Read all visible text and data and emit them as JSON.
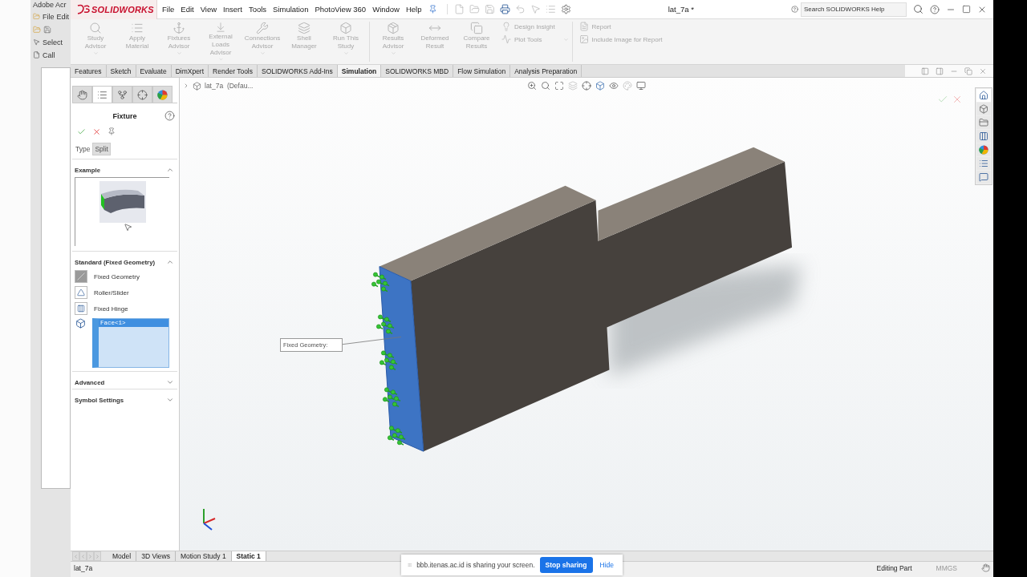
{
  "background_app": {
    "title": "Adobe Acr",
    "menu": [
      "File",
      "Edit"
    ],
    "tool": "Select",
    "tab": "Call"
  },
  "window": {
    "brand": "SOLIDWORKS",
    "menu": [
      "File",
      "Edit",
      "View",
      "Insert",
      "Tools",
      "Simulation",
      "PhotoView 360",
      "Window",
      "Help"
    ],
    "title": "lat_7a *",
    "search": {
      "placeholder": "Search SOLIDWORKS Help"
    }
  },
  "ribbon": {
    "groups": [
      {
        "large": [
          {
            "kind": "study",
            "label": "Study Advisor",
            "dropdown": true,
            "disabled": true
          },
          {
            "kind": "material",
            "label": "Apply Material",
            "dropdown": false,
            "disabled": true
          },
          {
            "kind": "fixtures",
            "label": "Fixtures Advisor",
            "dropdown": true,
            "disabled": true
          },
          {
            "kind": "loads",
            "label": "External Loads Advisor",
            "dropdown": true,
            "disabled": true
          },
          {
            "kind": "connections",
            "label": "Connections Advisor",
            "dropdown": true,
            "disabled": true
          },
          {
            "kind": "shell",
            "label": "Shell Manager",
            "dropdown": false,
            "disabled": true
          },
          {
            "kind": "run",
            "label": "Run This Study",
            "dropdown": true,
            "disabled": true
          }
        ]
      },
      {
        "large": [
          {
            "kind": "results",
            "label": "Results Advisor",
            "dropdown": true,
            "disabled": true
          },
          {
            "kind": "deformed",
            "label": "Deformed Result",
            "dropdown": false,
            "disabled": true
          },
          {
            "kind": "compare",
            "label": "Compare Results",
            "dropdown": false,
            "disabled": true
          }
        ],
        "small": [
          {
            "kind": "insight",
            "label": "Design Insight",
            "dropdown": false,
            "disabled": true
          },
          {
            "kind": "plot",
            "label": "Plot Tools",
            "dropdown": true,
            "disabled": true
          }
        ]
      },
      {
        "small": [
          {
            "kind": "report",
            "label": "Report",
            "dropdown": false,
            "disabled": true
          },
          {
            "kind": "image",
            "label": "Include Image for Report",
            "dropdown": false,
            "disabled": true
          }
        ]
      }
    ]
  },
  "command_tabs": [
    {
      "label": "Features",
      "selected": false
    },
    {
      "label": "Sketch",
      "selected": false
    },
    {
      "label": "Evaluate",
      "selected": false
    },
    {
      "label": "DimXpert",
      "selected": false
    },
    {
      "label": "Render Tools",
      "selected": false
    },
    {
      "label": "SOLIDWORKS Add-Ins",
      "selected": false
    },
    {
      "label": "Simulation",
      "selected": true
    },
    {
      "label": "SOLIDWORKS MBD",
      "selected": false
    },
    {
      "label": "Flow Simulation",
      "selected": false
    },
    {
      "label": "Analysis Preparation",
      "selected": false
    }
  ],
  "property_manager": {
    "tabs": [
      {
        "kind": "feature",
        "selected": false
      },
      {
        "kind": "property",
        "selected": true
      },
      {
        "kind": "config",
        "selected": false
      },
      {
        "kind": "dimxpert",
        "selected": false
      },
      {
        "kind": "display",
        "selected": false
      }
    ],
    "title": "Fixture",
    "type_tabs": [
      {
        "label": "Type",
        "selected": false
      },
      {
        "label": "Split",
        "selected": true
      }
    ],
    "example": {
      "title": "Example",
      "expanded": true
    },
    "standard": {
      "title": "Standard (Fixed Geometry)",
      "expanded": true,
      "options": [
        {
          "kind": "fixed",
          "label": "Fixed Geometry",
          "selected": true
        },
        {
          "kind": "roller",
          "label": "Roller/Slider",
          "selected": false
        },
        {
          "kind": "hinge",
          "label": "Fixed Hinge",
          "selected": false
        }
      ],
      "selection": [
        {
          "label": "Face<1>",
          "selected": true
        }
      ]
    },
    "more_sections": [
      {
        "title": "Advanced",
        "expanded": false
      },
      {
        "title": "Symbol Settings",
        "expanded": false
      }
    ]
  },
  "viewport": {
    "tree_item": "lat_7a  (Defau...",
    "callout": "Fixed Geometry:"
  },
  "bottom_tabs": [
    {
      "label": "Model",
      "selected": false
    },
    {
      "label": "3D Views",
      "selected": false
    },
    {
      "label": "Motion Study 1",
      "selected": false
    },
    {
      "label": "Static 1",
      "selected": true
    }
  ],
  "status_bar": {
    "file": "lat_7a",
    "mode": "Editing Part",
    "units": "MMGS"
  },
  "share_bar": {
    "message": "bbb.itenas.ac.id is sharing your screen.",
    "stop": "Stop sharing",
    "hide": "Hide"
  }
}
